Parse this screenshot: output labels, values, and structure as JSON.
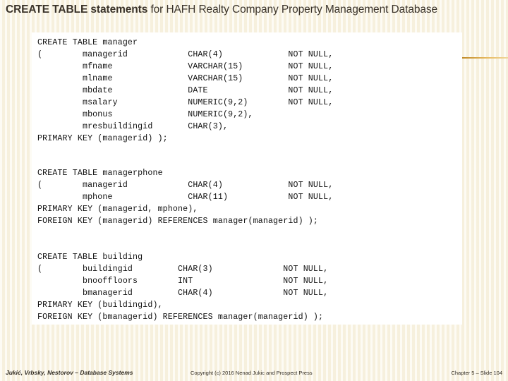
{
  "slide": {
    "title_strong": "CREATE TABLE statements",
    "title_rest": " for HAFH Realty Company Property Management Database",
    "background_color": "#fbf6e7",
    "panel_color": "#ffffff",
    "accent_color": "#c08a28"
  },
  "code": {
    "manager": "CREATE TABLE manager\n(        managerid            CHAR(4)             NOT NULL,\n         mfname               VARCHAR(15)         NOT NULL,\n         mlname               VARCHAR(15)         NOT NULL,\n         mbdate               DATE                NOT NULL,\n         msalary              NUMERIC(9,2)        NOT NULL,\n         mbonus               NUMERIC(9,2),\n         mresbuildingid       CHAR(3),\nPRIMARY KEY (managerid) );",
    "managerphone": "CREATE TABLE managerphone\n(        managerid            CHAR(4)             NOT NULL,\n         mphone               CHAR(11)            NOT NULL,\nPRIMARY KEY (managerid, mphone),\nFOREIGN KEY (managerid) REFERENCES manager(managerid) );",
    "building": "CREATE TABLE building\n(        buildingid         CHAR(3)              NOT NULL,\n         bnooffloors        INT                  NOT NULL,\n         bmanagerid         CHAR(4)              NOT NULL,\nPRIMARY KEY (buildingid),\nFOREIGN KEY (bmanagerid) REFERENCES manager(managerid) );"
  },
  "footer": {
    "left": "Jukić, Vrbsky, Nestorov – Database Systems",
    "center": "Copyright (c) 2016 Nenad Jukic and Prospect Press",
    "right": "Chapter 5 – Slide  104"
  }
}
